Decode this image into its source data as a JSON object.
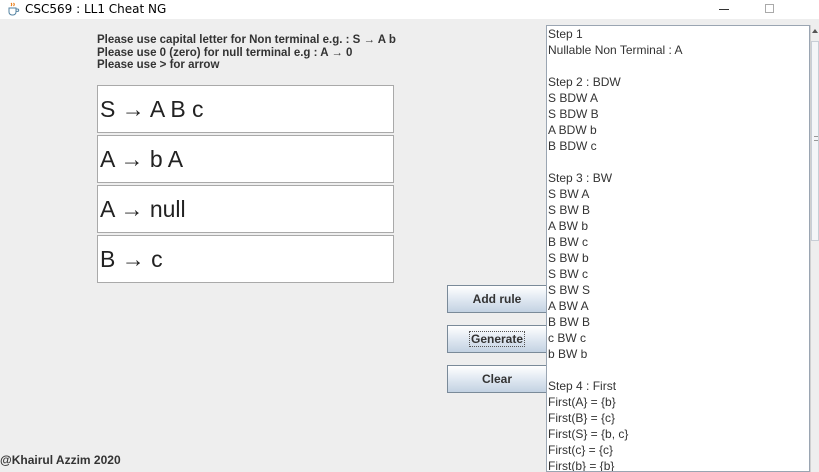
{
  "window": {
    "title": "CSC569 : LL1 Cheat NG",
    "icon": "java-cup-icon"
  },
  "instructions": [
    "Please use capital letter for Non terminal e.g. : S → A b",
    "Please use 0 (zero) for null terminal e.g : A → 0",
    "Please use > for arrow"
  ],
  "rules": [
    "S → A B c",
    "A → b A",
    "A → null",
    "B → c"
  ],
  "buttons": {
    "add_rule": "Add rule",
    "generate": "Generate",
    "clear": "Clear"
  },
  "footer": "@Khairul Azzim 2020",
  "output_lines": [
    "Step 1",
    "Nullable Non Terminal : A",
    "",
    "Step 2 : BDW",
    "S BDW A",
    "S BDW B",
    "A BDW b",
    "B BDW c",
    "",
    "Step 3 : BW",
    "S BW A",
    "S BW B",
    "A BW b",
    "B BW c",
    "S BW b",
    "S BW c",
    "S BW S",
    "A BW A",
    "B BW B",
    "c BW c",
    "b BW b",
    "",
    "Step 4 : First",
    "First(A} = {b}",
    "First(B} = {c}",
    "First(S} = {b, c}",
    "First(c} = {c}",
    "First(b} = {b}"
  ]
}
